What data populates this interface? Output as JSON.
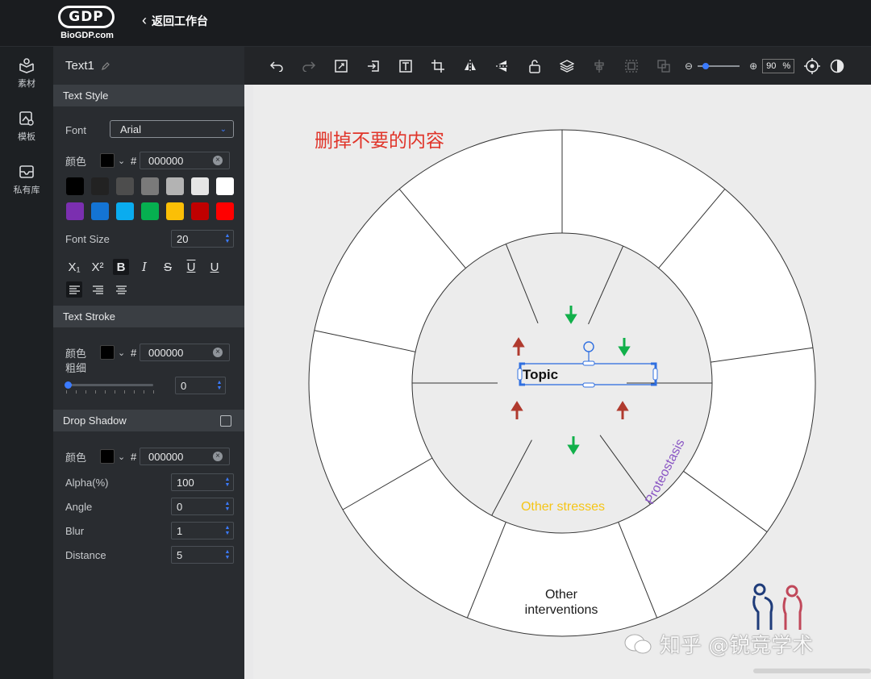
{
  "header": {
    "logo_mark": "GDP",
    "logo_text": "BioGDP.com",
    "back_label": "返回工作台"
  },
  "rail": {
    "items": [
      {
        "label": "素材",
        "icon": "material-icon"
      },
      {
        "label": "模板",
        "icon": "template-icon"
      },
      {
        "label": "私有库",
        "icon": "private-library-icon"
      }
    ]
  },
  "panel": {
    "object_name": "Text1",
    "text_style": {
      "heading": "Text Style",
      "font_label": "Font",
      "font_value": "Arial",
      "color_label": "颜色",
      "color_hex": "000000",
      "palette": [
        "#000000",
        "#222222",
        "#4d4d4d",
        "#7a7a7a",
        "#b3b3b3",
        "#e5e5e5",
        "#ffffff",
        "#7b2fb0",
        "#1474d4",
        "#0aacef",
        "#06b050",
        "#fbbf06",
        "#c00000",
        "#ff0000"
      ],
      "size_label": "Font Size",
      "size_value": "20",
      "format_buttons": [
        "X₁",
        "X²",
        "B",
        "I",
        "S",
        "U",
        "U"
      ]
    },
    "text_stroke": {
      "heading": "Text Stroke",
      "color_label": "颜色",
      "color_hex": "000000",
      "width_label": "粗细",
      "width_value": "0"
    },
    "drop_shadow": {
      "heading": "Drop Shadow",
      "color_label": "颜色",
      "color_hex": "000000",
      "alpha_label": "Alpha(%)",
      "alpha_value": "100",
      "angle_label": "Angle",
      "angle_value": "0",
      "blur_label": "Blur",
      "blur_value": "1",
      "distance_label": "Distance",
      "distance_value": "5"
    }
  },
  "toolbar": {
    "zoom_value": "90",
    "zoom_unit": "%"
  },
  "canvas": {
    "note": "删掉不要的内容",
    "topic": "Topic",
    "label_other_stresses": "Other stresses",
    "label_proteostasis": "Proteostasis",
    "label_other_interventions_1": "Other",
    "label_other_interventions_2": "interventions",
    "colors": {
      "stresses": "#f5c518",
      "proteostasis": "#8a56c4",
      "arrow_green": "#11b04a",
      "arrow_red": "#b03a2e",
      "selection": "#2f6fe0",
      "note": "#e0352a"
    }
  },
  "watermark": "知乎 @锐竞学术"
}
